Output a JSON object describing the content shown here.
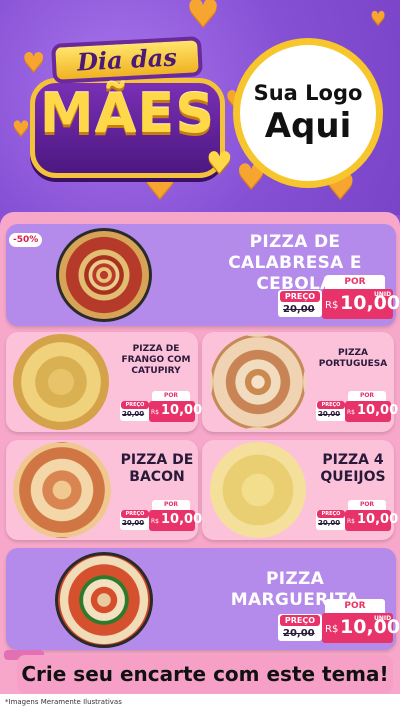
{
  "header": {
    "title_top": "Dia das",
    "title_main": "MÃES",
    "logo_line1": "Sua Logo",
    "logo_line2": "Aqui"
  },
  "badge": "-50%",
  "price_labels": {
    "preco": "PREÇO",
    "por": "POR",
    "rs": "R$",
    "unid": "UNID",
    "old": "20,00",
    "new": "10,00"
  },
  "items": [
    {
      "name": "PIZZA DE CALABRESA E CEBOLA"
    },
    {
      "name": "PIZZA DE FRANGO COM CATUPIRY"
    },
    {
      "name": "PIZZA PORTUGUESA"
    },
    {
      "name": "PIZZA DE BACON"
    },
    {
      "name": "PIZZA 4 QUEIJOS"
    },
    {
      "name": "PIZZA MARGUERITA"
    }
  ],
  "cta": "Crie seu encarte com este tema!",
  "footer": "*Imagens Meramente Ilustrativas",
  "colors": {
    "accent": "#e8336a",
    "purple": "#8a4fd6",
    "pink": "#f7a7c9",
    "gold": "#f7c62c"
  }
}
